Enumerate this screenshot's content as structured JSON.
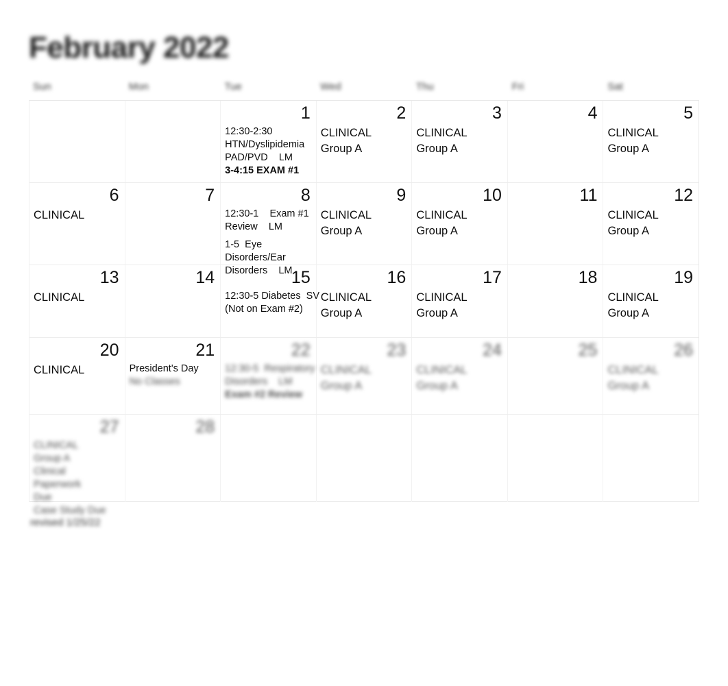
{
  "calendar": {
    "title": "February 2022",
    "footer_note": "revised 1/25/22",
    "day_headers": [
      "Sun",
      "Mon",
      "Tue",
      "Wed",
      "Thu",
      "Fri",
      "Sat"
    ],
    "weeks": [
      {
        "days": [
          {
            "num": "",
            "blurred_num": false,
            "events": []
          },
          {
            "num": "",
            "blurred_num": false,
            "events": []
          },
          {
            "num": "1",
            "blurred_num": false,
            "events": [
              {
                "text": "12:30-2:30\nHTN/Dyslipidemia\nPAD/PVD    LM",
                "style": "small wide",
                "blurred": false
              },
              {
                "text": "3-4:15 EXAM #1",
                "style": "small bold wide",
                "blurred": false
              }
            ]
          },
          {
            "num": "2",
            "blurred_num": false,
            "events": [
              {
                "text": "CLINICAL\nGroup A",
                "style": "big",
                "blurred": false
              }
            ]
          },
          {
            "num": "3",
            "blurred_num": false,
            "events": [
              {
                "text": "CLINICAL\nGroup A",
                "style": "big",
                "blurred": false
              }
            ]
          },
          {
            "num": "4",
            "blurred_num": false,
            "events": []
          },
          {
            "num": "5",
            "blurred_num": false,
            "events": [
              {
                "text": "CLINICAL\nGroup A",
                "style": "big",
                "blurred": false
              }
            ]
          }
        ]
      },
      {
        "days": [
          {
            "num": "6",
            "blurred_num": false,
            "events": [
              {
                "text": "CLINICAL",
                "style": "big",
                "blurred": false
              }
            ]
          },
          {
            "num": "7",
            "blurred_num": false,
            "events": []
          },
          {
            "num": "8",
            "blurred_num": false,
            "events": [
              {
                "text": "12:30-1    Exam #1\nReview    LM",
                "style": "small wide",
                "blurred": false
              },
              {
                "text": "1-5  Eye\nDisorders/Ear\nDisorders    LM",
                "style": "small spaced",
                "blurred": false
              }
            ]
          },
          {
            "num": "9",
            "blurred_num": false,
            "events": [
              {
                "text": "CLINICAL\nGroup A",
                "style": "big",
                "blurred": false
              }
            ]
          },
          {
            "num": "10",
            "blurred_num": false,
            "events": [
              {
                "text": "CLINICAL\nGroup A",
                "style": "big",
                "blurred": false
              }
            ]
          },
          {
            "num": "11",
            "blurred_num": false,
            "events": []
          },
          {
            "num": "12",
            "blurred_num": false,
            "events": [
              {
                "text": "CLINICAL\nGroup A",
                "style": "big",
                "blurred": false
              }
            ]
          }
        ]
      },
      {
        "days": [
          {
            "num": "13",
            "blurred_num": false,
            "events": [
              {
                "text": "CLINICAL",
                "style": "big",
                "blurred": false
              }
            ]
          },
          {
            "num": "14",
            "blurred_num": false,
            "events": []
          },
          {
            "num": "15",
            "blurred_num": false,
            "events": [
              {
                "text": "12:30-5 Diabetes  SV\n(Not on Exam #2)",
                "style": "small wide",
                "blurred": false
              }
            ]
          },
          {
            "num": "16",
            "blurred_num": false,
            "events": [
              {
                "text": "CLINICAL\nGroup A",
                "style": "big",
                "blurred": false
              }
            ]
          },
          {
            "num": "17",
            "blurred_num": false,
            "events": [
              {
                "text": "CLINICAL\nGroup A",
                "style": "big",
                "blurred": false
              }
            ]
          },
          {
            "num": "18",
            "blurred_num": false,
            "events": []
          },
          {
            "num": "19",
            "blurred_num": false,
            "events": [
              {
                "text": "CLINICAL\nGroup A",
                "style": "big",
                "blurred": false
              }
            ]
          }
        ]
      },
      {
        "days": [
          {
            "num": "20",
            "blurred_num": false,
            "events": [
              {
                "text": "CLINICAL",
                "style": "big",
                "blurred": false
              }
            ]
          },
          {
            "num": "21",
            "blurred_num": false,
            "events": [
              {
                "text": "President's Day",
                "style": "small",
                "blurred": false
              },
              {
                "text": "No Classes",
                "style": "small",
                "blurred": true
              }
            ]
          },
          {
            "num": "22",
            "blurred_num": true,
            "events": [
              {
                "text": "12:30-5  Respiratory\nDisorders    LM",
                "style": "small wide",
                "blurred": true
              },
              {
                "text": "Exam #2 Review",
                "style": "small bold wide",
                "blurred": true
              }
            ]
          },
          {
            "num": "23",
            "blurred_num": true,
            "events": [
              {
                "text": "CLINICAL\nGroup A",
                "style": "big",
                "blurred": true
              }
            ]
          },
          {
            "num": "24",
            "blurred_num": true,
            "events": [
              {
                "text": "CLINICAL\nGroup A",
                "style": "big",
                "blurred": true
              }
            ]
          },
          {
            "num": "25",
            "blurred_num": true,
            "events": []
          },
          {
            "num": "26",
            "blurred_num": true,
            "events": [
              {
                "text": "CLINICAL\nGroup A",
                "style": "big",
                "blurred": true
              }
            ]
          }
        ]
      },
      {
        "days": [
          {
            "num": "27",
            "blurred_num": true,
            "events": [
              {
                "text": "CLINICAL\nGroup A\nClinical\nPaperwork\nDue\nCase Study Due",
                "style": "small wide",
                "blurred": true
              }
            ]
          },
          {
            "num": "28",
            "blurred_num": true,
            "events": []
          },
          {
            "num": "",
            "blurred_num": false,
            "events": []
          },
          {
            "num": "",
            "blurred_num": false,
            "events": []
          },
          {
            "num": "",
            "blurred_num": false,
            "events": []
          },
          {
            "num": "",
            "blurred_num": false,
            "events": []
          },
          {
            "num": "",
            "blurred_num": false,
            "events": []
          }
        ]
      }
    ]
  }
}
